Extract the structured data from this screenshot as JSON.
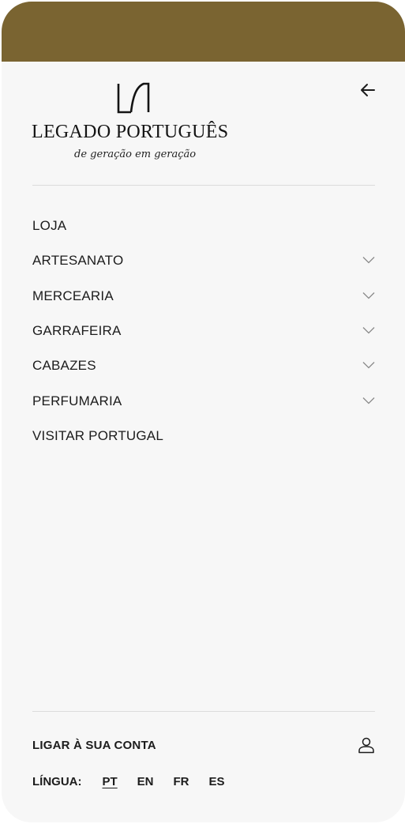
{
  "brand": {
    "name": "LEGADO PORTUGUÊS",
    "tagline": "de geração em geração",
    "color": "#7a6431"
  },
  "header": {
    "back_icon": "arrow-left-icon"
  },
  "menu": {
    "items": [
      {
        "label": "LOJA",
        "has_submenu": false
      },
      {
        "label": "ARTESANATO",
        "has_submenu": true
      },
      {
        "label": "MERCEARIA",
        "has_submenu": true
      },
      {
        "label": "GARRAFEIRA",
        "has_submenu": true
      },
      {
        "label": "CABAZES",
        "has_submenu": true
      },
      {
        "label": "PERFUMARIA",
        "has_submenu": true
      },
      {
        "label": "VISITAR PORTUGAL",
        "has_submenu": false
      }
    ],
    "chevron_icon": "chevron-down-icon"
  },
  "account": {
    "label": "LIGAR À SUA CONTA",
    "icon": "user-icon"
  },
  "language": {
    "label": "LÍNGUA:",
    "options": [
      "PT",
      "EN",
      "FR",
      "ES"
    ],
    "selected": "PT"
  }
}
